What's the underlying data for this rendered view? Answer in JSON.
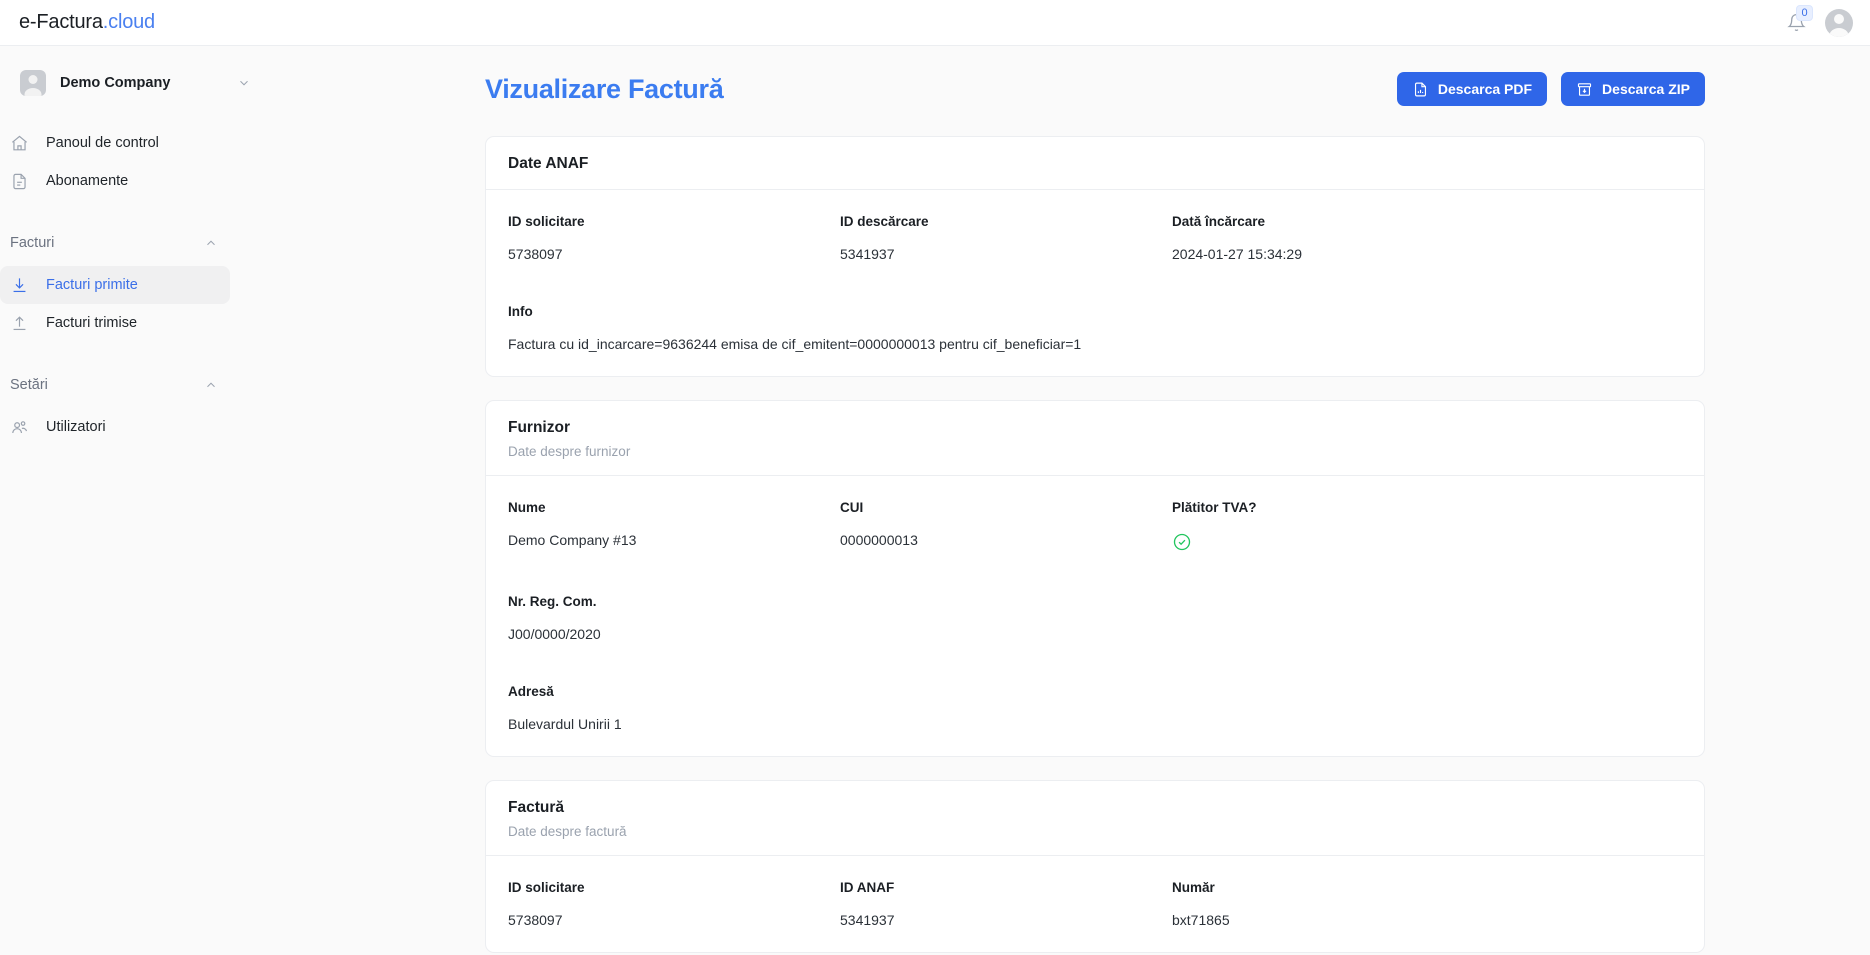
{
  "topbar": {
    "brand_main": "e-Factura",
    "brand_suffix": ".cloud",
    "bell_icon": "bell-icon",
    "notification_count": "0",
    "avatar_icon": "user-avatar"
  },
  "sidebar": {
    "company": {
      "name": "Demo Company",
      "chevron_icon": "chevron-down-icon",
      "avatar_icon": "company-avatar"
    },
    "items": [
      {
        "label": "Panoul de control",
        "icon": "home-icon",
        "active": false
      },
      {
        "label": "Abonamente",
        "icon": "document-icon",
        "active": false
      }
    ],
    "groups": [
      {
        "title": "Facturi",
        "chevron_icon": "chevron-up-icon",
        "items": [
          {
            "label": "Facturi primite",
            "icon": "download-icon",
            "active": true
          },
          {
            "label": "Facturi trimise",
            "icon": "upload-icon",
            "active": false
          }
        ]
      },
      {
        "title": "Setări",
        "chevron_icon": "chevron-up-icon",
        "items": [
          {
            "label": "Utilizatori",
            "icon": "users-icon",
            "active": false
          }
        ]
      }
    ]
  },
  "main": {
    "title": "Vizualizare Factură",
    "buttons": [
      {
        "label": "Descarca PDF",
        "icon": "file-chart-icon"
      },
      {
        "label": "Descarca ZIP",
        "icon": "archive-download-icon"
      }
    ],
    "cards": [
      {
        "title": "Date ANAF",
        "subtitle": "",
        "rows": [
          [
            {
              "label": "ID solicitare",
              "value": "5738097"
            },
            {
              "label": "ID descărcare",
              "value": "5341937"
            },
            {
              "label": "Dată încărcare",
              "value": "2024-01-27 15:34:29"
            }
          ],
          [
            {
              "label": "Info",
              "value": "Factura cu id_incarcare=9636244 emisa de cif_emitent=0000000013 pentru cif_beneficiar=1",
              "wide": true
            }
          ]
        ]
      },
      {
        "title": "Furnizor",
        "subtitle": "Date despre furnizor",
        "rows": [
          [
            {
              "label": "Nume",
              "value": "Demo Company #13"
            },
            {
              "label": "CUI",
              "value": "0000000013"
            },
            {
              "label": "Plătitor TVA?",
              "value": "",
              "icon": "check-circle-icon"
            }
          ],
          [
            {
              "label": "Nr. Reg. Com.",
              "value": "J00/0000/2020"
            }
          ],
          [
            {
              "label": "Adresă",
              "value": "Bulevardul Unirii 1"
            }
          ]
        ]
      },
      {
        "title": "Factură",
        "subtitle": "Date despre factură",
        "rows": [
          [
            {
              "label": "ID solicitare",
              "value": "5738097"
            },
            {
              "label": "ID ANAF",
              "value": "5341937"
            },
            {
              "label": "Număr",
              "value": "bxt71865"
            }
          ]
        ]
      }
    ]
  },
  "colors": {
    "accent_blue": "#2f66e8",
    "title_blue": "#3b7cf0",
    "success_green": "#22c55e",
    "page_background": "#fafafa",
    "card_background": "#ffffff"
  }
}
